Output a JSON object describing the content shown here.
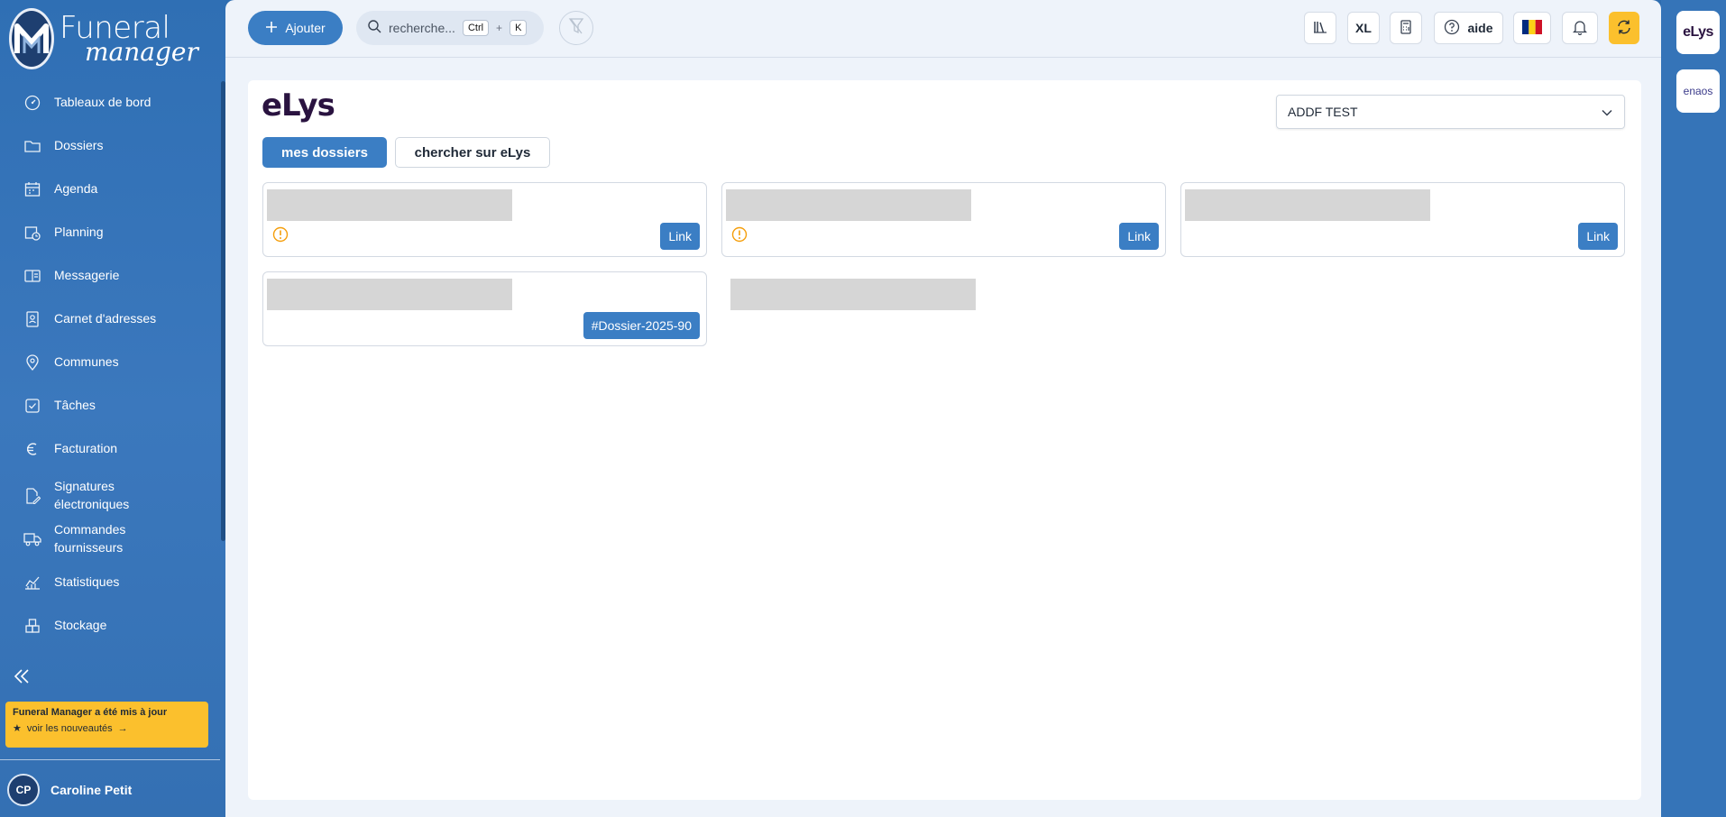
{
  "app": {
    "logo_line1": "Funeral",
    "logo_line2": "manager"
  },
  "sidebar": {
    "items": [
      {
        "label": "Tableaux de bord",
        "icon": "dashboard-icon"
      },
      {
        "label": "Dossiers",
        "icon": "folder-icon"
      },
      {
        "label": "Agenda",
        "icon": "calendar-icon"
      },
      {
        "label": "Planning",
        "icon": "planning-icon"
      },
      {
        "label": "Messagerie",
        "icon": "mail-icon"
      },
      {
        "label": "Carnet d'adresses",
        "icon": "address-book-icon"
      },
      {
        "label": "Communes",
        "icon": "location-pin-icon"
      },
      {
        "label": "Tâches",
        "icon": "checkbox-icon"
      },
      {
        "label": "Facturation",
        "icon": "euro-icon"
      },
      {
        "label": "Signatures électroniques",
        "icon": "signature-icon"
      },
      {
        "label": "Commandes fournisseurs",
        "icon": "truck-icon"
      },
      {
        "label": "Statistiques",
        "icon": "chart-icon"
      },
      {
        "label": "Stockage",
        "icon": "boxes-icon"
      }
    ]
  },
  "update_banner": {
    "title": "Funeral Manager a été mis à jour",
    "link": "voir les nouveautés"
  },
  "user": {
    "initials": "CP",
    "name": "Caroline Petit"
  },
  "topbar": {
    "add_label": "Ajouter",
    "search_placeholder": "recherche...",
    "shortcut_key1": "Ctrl",
    "shortcut_plus": "+",
    "shortcut_key2": "K",
    "xl_label": "XL",
    "help_label": "aide"
  },
  "content": {
    "brand": "eLys",
    "select_value": "ADDF TEST",
    "tabs": {
      "active": "mes dossiers",
      "inactive": "chercher sur eLys"
    },
    "tiles": [
      {
        "link": "Link",
        "warning": true
      },
      {
        "link": "Link",
        "warning": true
      },
      {
        "link": "Link",
        "warning": false
      },
      {
        "link": "#Dossier-2025-90",
        "warning": false
      }
    ]
  },
  "rail": {
    "item1": "eLys",
    "item2": "enaos"
  },
  "colors": {
    "accent": "#3b7ec4",
    "sidebar": "#2f6fb4",
    "warning": "#f59e0b",
    "banner": "#fbc02d"
  }
}
